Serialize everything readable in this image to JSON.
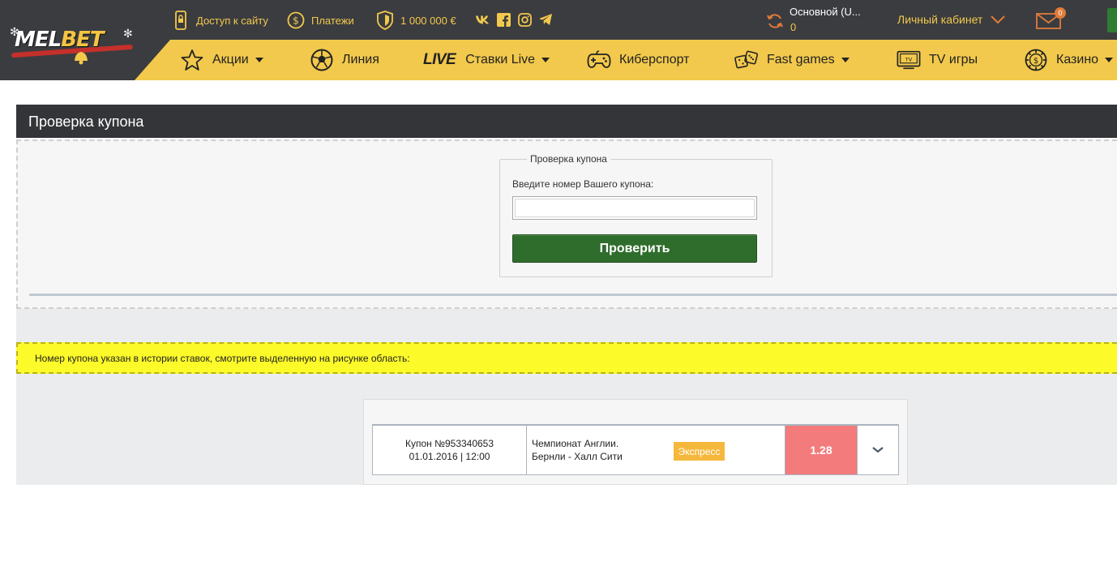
{
  "header": {
    "logo_text_white": "MEL",
    "logo_text_yellow": "BET",
    "site_access": "Доступ к сайту",
    "payments": "Платежи",
    "bonus": "1 000 000 €",
    "social": [
      "vk-icon",
      "facebook-icon",
      "instagram-icon",
      "telegram-icon"
    ],
    "account_name": "Основной (U...",
    "balance": "0",
    "cabinet": "Личный кабинет",
    "mail_count": "0"
  },
  "nav": {
    "items": [
      {
        "label": "Акции",
        "icon": "star-icon",
        "dropdown": true
      },
      {
        "label": "Линия",
        "icon": "soccer-ball-icon",
        "dropdown": false
      },
      {
        "label": "Ставки Live",
        "prefix": "LIVE",
        "dropdown": true
      },
      {
        "label": "Киберспорт",
        "icon": "gamepad-icon",
        "dropdown": false
      },
      {
        "label": "Fast games",
        "icon": "dice-icon",
        "dropdown": true
      },
      {
        "label": "TV игры",
        "icon": "tv-icon",
        "dropdown": false
      },
      {
        "label": "Казино",
        "icon": "casino-chip-icon",
        "dropdown": true
      }
    ]
  },
  "main": {
    "panel_title": "Проверка купона",
    "form": {
      "legend": "Проверка купона",
      "field_label": "Введите номер Вашего купона:",
      "input_value": "",
      "button_label": "Проверить"
    },
    "notice": "Номер купона указан в истории ставок, смотрите выделенную на рисунке область:",
    "coupon": {
      "number": "Купон №953340653",
      "datetime": "01.01.2016 | 12:00",
      "league": "Чемпионат Англии.",
      "match": "Бернли - Халл Сити",
      "type_badge": "Экспресс",
      "odds": "1.28"
    }
  },
  "colors": {
    "header_bg": "#3b3c40",
    "accent_yellow": "#f2c94c",
    "button_green": "#2f6d2c",
    "notice_yellow": "#fdfa29",
    "odds_red": "#f37b7c",
    "badge_orange": "#f5b83d"
  }
}
